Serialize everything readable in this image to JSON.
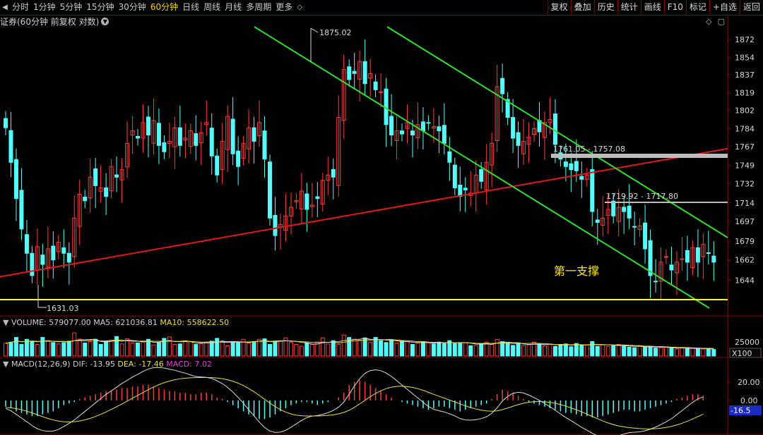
{
  "toolbar": {
    "periods": [
      "分时",
      "1分钟",
      "5分钟",
      "15分钟",
      "30分钟",
      "60分钟",
      "日线",
      "周线",
      "月线",
      "多周期",
      "更多"
    ],
    "active_period": "60分钟",
    "buttons": [
      "复权",
      "叠加",
      "历史",
      "统计",
      "画线",
      "F10",
      "标记",
      "+自选",
      "返回"
    ]
  },
  "chart_header": {
    "title": "证券(60分钟 前复权 对数)"
  },
  "colors": {
    "up": "#ff3c3c",
    "down": "#54fcfc",
    "axis": "#8b0000",
    "channel": "#33dd33",
    "trendline": "#e01818",
    "support": "#ffff00",
    "resistance": "#bdbdbd",
    "annotation": "#ffe800"
  },
  "chart_data": {
    "type": "candlestick",
    "price_axis": {
      "ticks": [
        "1872",
        "1854",
        "1837",
        "1819",
        "1802",
        "1784",
        "1767",
        "1749",
        "1732",
        "1714",
        "1697",
        "1679",
        "1662",
        "1644"
      ],
      "range": [
        1628,
        1880
      ],
      "scale": "log"
    },
    "closes": [
      1785,
      1752,
      1718,
      1690,
      1668,
      1648,
      1674,
      1658,
      1672,
      1662,
      1678,
      1668,
      1660,
      1700,
      1722,
      1716,
      1738,
      1730,
      1728,
      1720,
      1748,
      1738,
      1745,
      1770,
      1782,
      1775,
      1790,
      1778,
      1792,
      1768,
      1762,
      1772,
      1785,
      1768,
      1775,
      1782,
      1768,
      1780,
      1790,
      1758,
      1740,
      1772,
      1796,
      1760,
      1748,
      1770,
      1785,
      1772,
      1790,
      1755,
      1700,
      1684,
      1694,
      1702,
      1710,
      1716,
      1725,
      1708,
      1712,
      1718,
      1735,
      1740,
      1738,
      1795,
      1842,
      1832,
      1838,
      1850,
      1828,
      1838,
      1822,
      1820,
      1788,
      1778,
      1782,
      1779,
      1790,
      1778,
      1788,
      1782,
      1790,
      1786,
      1782,
      1770,
      1752,
      1728,
      1720,
      1726,
      1723,
      1740,
      1734,
      1752,
      1770,
      1825,
      1818,
      1795,
      1775,
      1768,
      1772,
      1776,
      1784,
      1781,
      1790,
      1793,
      1769,
      1755,
      1748,
      1745,
      1744,
      1736,
      1740,
      1706,
      1696,
      1700,
      1708,
      1702,
      1710,
      1706,
      1700,
      1692,
      1693,
      1672,
      1648,
      1643,
      1660,
      1665,
      1653,
      1660,
      1663,
      1660,
      1673,
      1660,
      1676,
      1668,
      1660
    ],
    "volume_panel": {
      "label": "VOLUME: 579077.00",
      "ma5": "MA5: 621036.81",
      "ma10": "MA10: 558622.50",
      "axis_ticks": [
        "25000",
        "X100"
      ],
      "bar_heights": [
        0.55,
        0.6,
        0.8,
        0.5,
        0.72,
        0.62,
        0.5,
        0.8,
        0.66,
        0.58,
        0.52,
        0.58,
        0.64,
        1.0,
        0.73,
        0.56,
        0.62,
        0.72,
        0.5,
        0.63,
        0.68,
        0.84,
        0.52,
        0.74,
        0.56,
        0.56,
        0.64,
        0.72,
        0.48,
        0.57,
        0.76,
        0.82,
        0.5,
        0.52,
        0.65,
        0.62,
        0.5,
        0.52,
        0.56,
        0.64,
        0.76,
        0.66,
        0.44,
        0.62,
        0.58,
        0.72,
        0.56,
        0.62,
        0.72,
        0.74,
        0.5,
        0.64,
        0.66,
        0.78,
        0.58,
        0.5,
        0.42,
        0.56,
        0.5,
        0.6,
        0.78,
        0.52,
        0.66,
        0.5,
        0.9,
        0.8,
        0.72,
        0.68,
        0.78,
        0.6,
        0.8,
        0.66,
        0.58,
        0.68,
        0.56,
        0.64,
        0.62,
        0.5,
        0.56,
        0.62,
        0.58,
        0.52,
        0.6,
        0.54,
        0.66,
        0.54,
        0.56,
        0.58,
        0.44,
        0.46,
        0.52,
        0.6,
        0.5,
        0.72,
        0.62,
        0.56,
        0.46,
        0.52,
        0.46,
        0.48,
        0.6,
        0.5,
        0.44,
        0.52,
        0.42,
        0.5,
        0.52,
        0.4,
        0.54,
        0.46,
        0.48,
        0.62,
        0.42,
        0.48,
        0.42,
        0.44,
        0.5,
        0.42,
        0.38,
        0.36,
        0.44,
        0.4,
        0.4,
        0.34,
        0.36,
        0.38,
        0.34,
        0.3,
        0.36,
        0.32,
        0.34,
        0.3,
        0.3,
        0.32,
        0.28
      ]
    },
    "macd_panel": {
      "label": "MACD(12,26,9)",
      "dif": "DIF: -13.95",
      "dea": "DEA: -17.46",
      "macd": "MACD: 7.02",
      "axis_ticks": [
        "20.00",
        "0.00"
      ],
      "current_value": "-16.5",
      "histogram": [
        -8,
        -10,
        -14,
        -16,
        -18,
        -20,
        -20,
        -18,
        -16,
        -14,
        -10,
        -6,
        -4,
        -2,
        2,
        4,
        6,
        8,
        10,
        12,
        12,
        14,
        16,
        16,
        18,
        18,
        20,
        20,
        18,
        16,
        14,
        12,
        12,
        10,
        10,
        8,
        8,
        10,
        10,
        8,
        4,
        2,
        -2,
        -6,
        -10,
        -14,
        -18,
        -20,
        -24,
        -24,
        -22,
        -18,
        -14,
        -10,
        -6,
        -4,
        -2,
        -2,
        -4,
        -6,
        -4,
        -2,
        0,
        4,
        10,
        20,
        24,
        26,
        24,
        20,
        16,
        12,
        8,
        4,
        0,
        -2,
        -4,
        -6,
        -8,
        -10,
        -12,
        -10,
        -8,
        -8,
        -10,
        -12,
        -14,
        -12,
        -10,
        -8,
        -6,
        -4,
        2,
        8,
        14,
        12,
        10,
        6,
        2,
        -2,
        -4,
        -6,
        -8,
        -10,
        -12,
        -14,
        -16,
        -16,
        -18,
        -20,
        -20,
        -22,
        -22,
        -20,
        -18,
        -16,
        -14,
        -12,
        -12,
        -14,
        -14,
        -12,
        -10,
        -8,
        -6,
        -4,
        -2,
        2,
        4,
        6,
        8,
        8,
        6
      ]
    },
    "annotations": {
      "high_label": "1875.02",
      "low_label": "1631.03",
      "resistance1_label": "1761.05 - 1757.08",
      "resistance2_label": "1719.92 - 1717.80",
      "support_label": "第一支撑"
    }
  }
}
